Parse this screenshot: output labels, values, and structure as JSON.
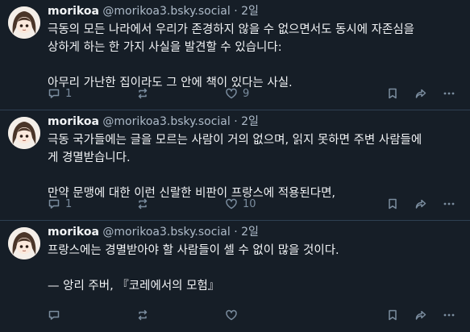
{
  "posts": [
    {
      "author": "morikoa",
      "handle": "@morikoa3.bsky.social",
      "sep": "·",
      "time": "2일",
      "lines": [
        "극동의 모든 나라에서 우리가 존경하지 않을 수 없으면서도 동시에 자존심을",
        "상하게 하는 한 가지 사실을 발견할 수 있습니다:",
        "",
        "아무리 가난한 집이라도 그 안에 책이 있다는 사실."
      ],
      "replies": "1",
      "reposts": "",
      "likes": "9"
    },
    {
      "author": "morikoa",
      "handle": "@morikoa3.bsky.social",
      "sep": "·",
      "time": "2일",
      "lines": [
        "극동 국가들에는 글을 모르는 사람이 거의 없으며, 읽지 못하면 주변 사람들에",
        "게 경멸받습니다.",
        "",
        "만약 문맹에 대한 이런 신랄한 비판이 프랑스에 적용된다면,"
      ],
      "replies": "1",
      "reposts": "",
      "likes": "10"
    },
    {
      "author": "morikoa",
      "handle": "@morikoa3.bsky.social",
      "sep": "·",
      "time": "2일",
      "lines": [
        "프랑스에는 경멸받아야 할 사람들이 셀 수 없이 많을 것이다.",
        "",
        "— 앙리 주버, 『코레에서의 모험』"
      ],
      "replies": "",
      "reposts": "",
      "likes": ""
    }
  ],
  "icons": {
    "reply": "reply-icon",
    "repost": "repost-icon",
    "like": "heart-icon",
    "bookmark": "bookmark-icon",
    "share": "share-icon",
    "more": "more-icon"
  },
  "colors": {
    "background": "#161e27",
    "text": "#f1f3f5",
    "muted": "#aebbc9",
    "icon": "#7b8d9f",
    "divider": "#2e4052"
  }
}
